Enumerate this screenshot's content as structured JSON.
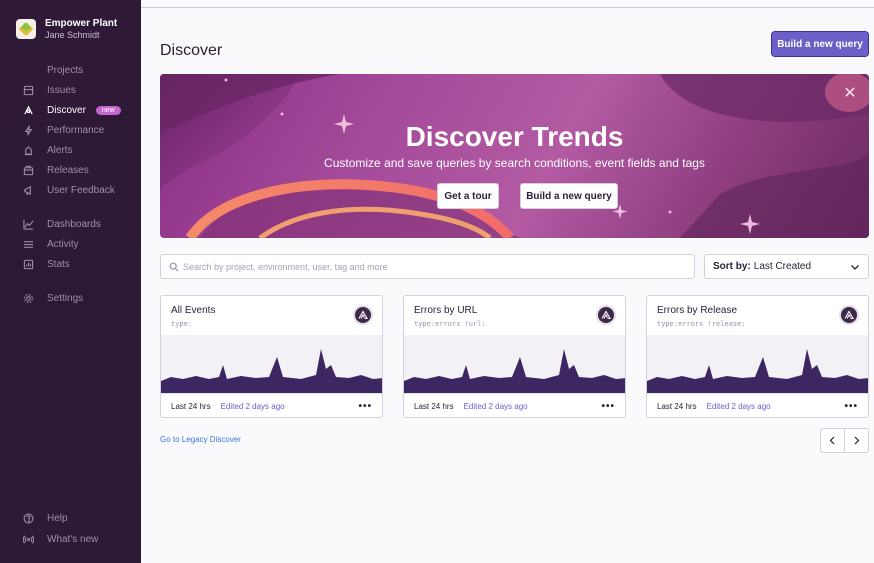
{
  "org": {
    "name": "Empower Plant",
    "user": "Jane Schmidt"
  },
  "nav": {
    "items": [
      {
        "label": "Projects",
        "icon": "projects-icon"
      },
      {
        "label": "Issues",
        "icon": "issues-icon"
      },
      {
        "label": "Discover",
        "icon": "discover-icon",
        "active": true,
        "badge": "new"
      },
      {
        "label": "Performance",
        "icon": "lightning-icon"
      },
      {
        "label": "Alerts",
        "icon": "siren-icon"
      },
      {
        "label": "Releases",
        "icon": "package-icon"
      },
      {
        "label": "User Feedback",
        "icon": "megaphone-icon"
      },
      {
        "label": "Dashboards",
        "icon": "graph-icon"
      },
      {
        "label": "Activity",
        "icon": "list-icon"
      },
      {
        "label": "Stats",
        "icon": "stats-icon"
      },
      {
        "label": "Settings",
        "icon": "gear-icon"
      }
    ],
    "bottom": [
      {
        "label": "Help",
        "icon": "question-icon"
      },
      {
        "label": "What's new",
        "icon": "broadcast-icon"
      }
    ]
  },
  "page": {
    "title": "Discover",
    "build_query_label": "Build a new query"
  },
  "banner": {
    "title": "Discover Trends",
    "subtitle": "Customize and save queries by search conditions, event fields and tags",
    "tour_label": "Get a tour",
    "build_label": "Build a new query"
  },
  "search": {
    "placeholder": "Search by project, environment, user, tag and more"
  },
  "sort": {
    "label": "Sort by:",
    "value": "Last Created"
  },
  "cards": [
    {
      "name": "All Events",
      "query": "type:",
      "range": "Last 24 hrs",
      "edited": "Edited 2 days ago"
    },
    {
      "name": "Errors by URL",
      "query": "type:errors !url:",
      "range": "Last 24 hrs",
      "edited": "Edited 2 days ago"
    },
    {
      "name": "Errors by Release",
      "query": "type:errors !release:",
      "range": "Last 24 hrs",
      "edited": "Edited 2 days ago"
    }
  ],
  "more_label": "•••",
  "legacy_link": "Go to Legacy Discover",
  "colors": {
    "accent": "#6c5fc7",
    "sidebar": "#2f1937",
    "chart_fill": "#3c2763"
  }
}
